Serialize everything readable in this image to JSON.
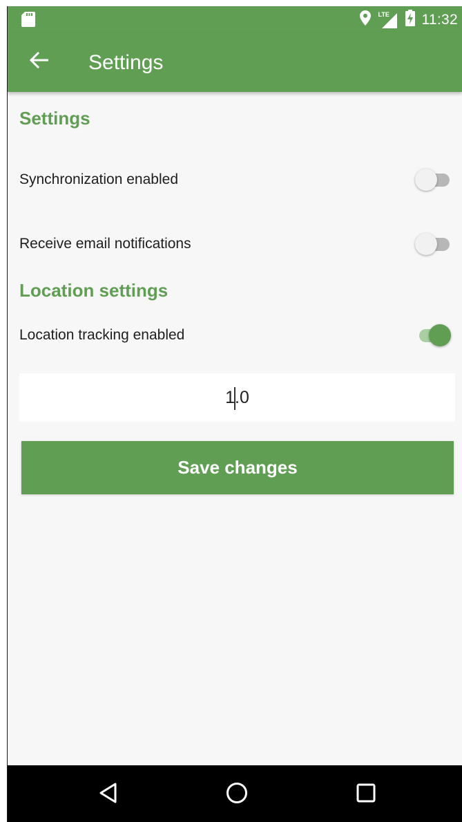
{
  "status_bar": {
    "left_icon": "sd-card-icon",
    "icons": [
      "location-pin-icon",
      "lte-signal-icon",
      "battery-charging-icon"
    ],
    "lte_label": "LTE",
    "time": "11:32"
  },
  "app_bar": {
    "back_icon": "arrow-back-icon",
    "title": "Settings"
  },
  "sections": {
    "general": {
      "title": "Settings",
      "items": [
        {
          "label": "Synchronization enabled",
          "enabled": false
        },
        {
          "label": "Receive email notifications",
          "enabled": false
        }
      ]
    },
    "location": {
      "title": "Location settings",
      "items": [
        {
          "label": "Location tracking enabled",
          "enabled": true
        }
      ]
    }
  },
  "location_input": {
    "value": "1.0"
  },
  "save_button": {
    "label": "Save changes"
  },
  "nav_bar": {
    "buttons": [
      "back-triangle-icon",
      "home-circle-icon",
      "recents-square-icon"
    ]
  },
  "colors": {
    "primary": "#5f9e53",
    "switch_on_track": "#aacfa3",
    "background": "#f7f7f7"
  }
}
